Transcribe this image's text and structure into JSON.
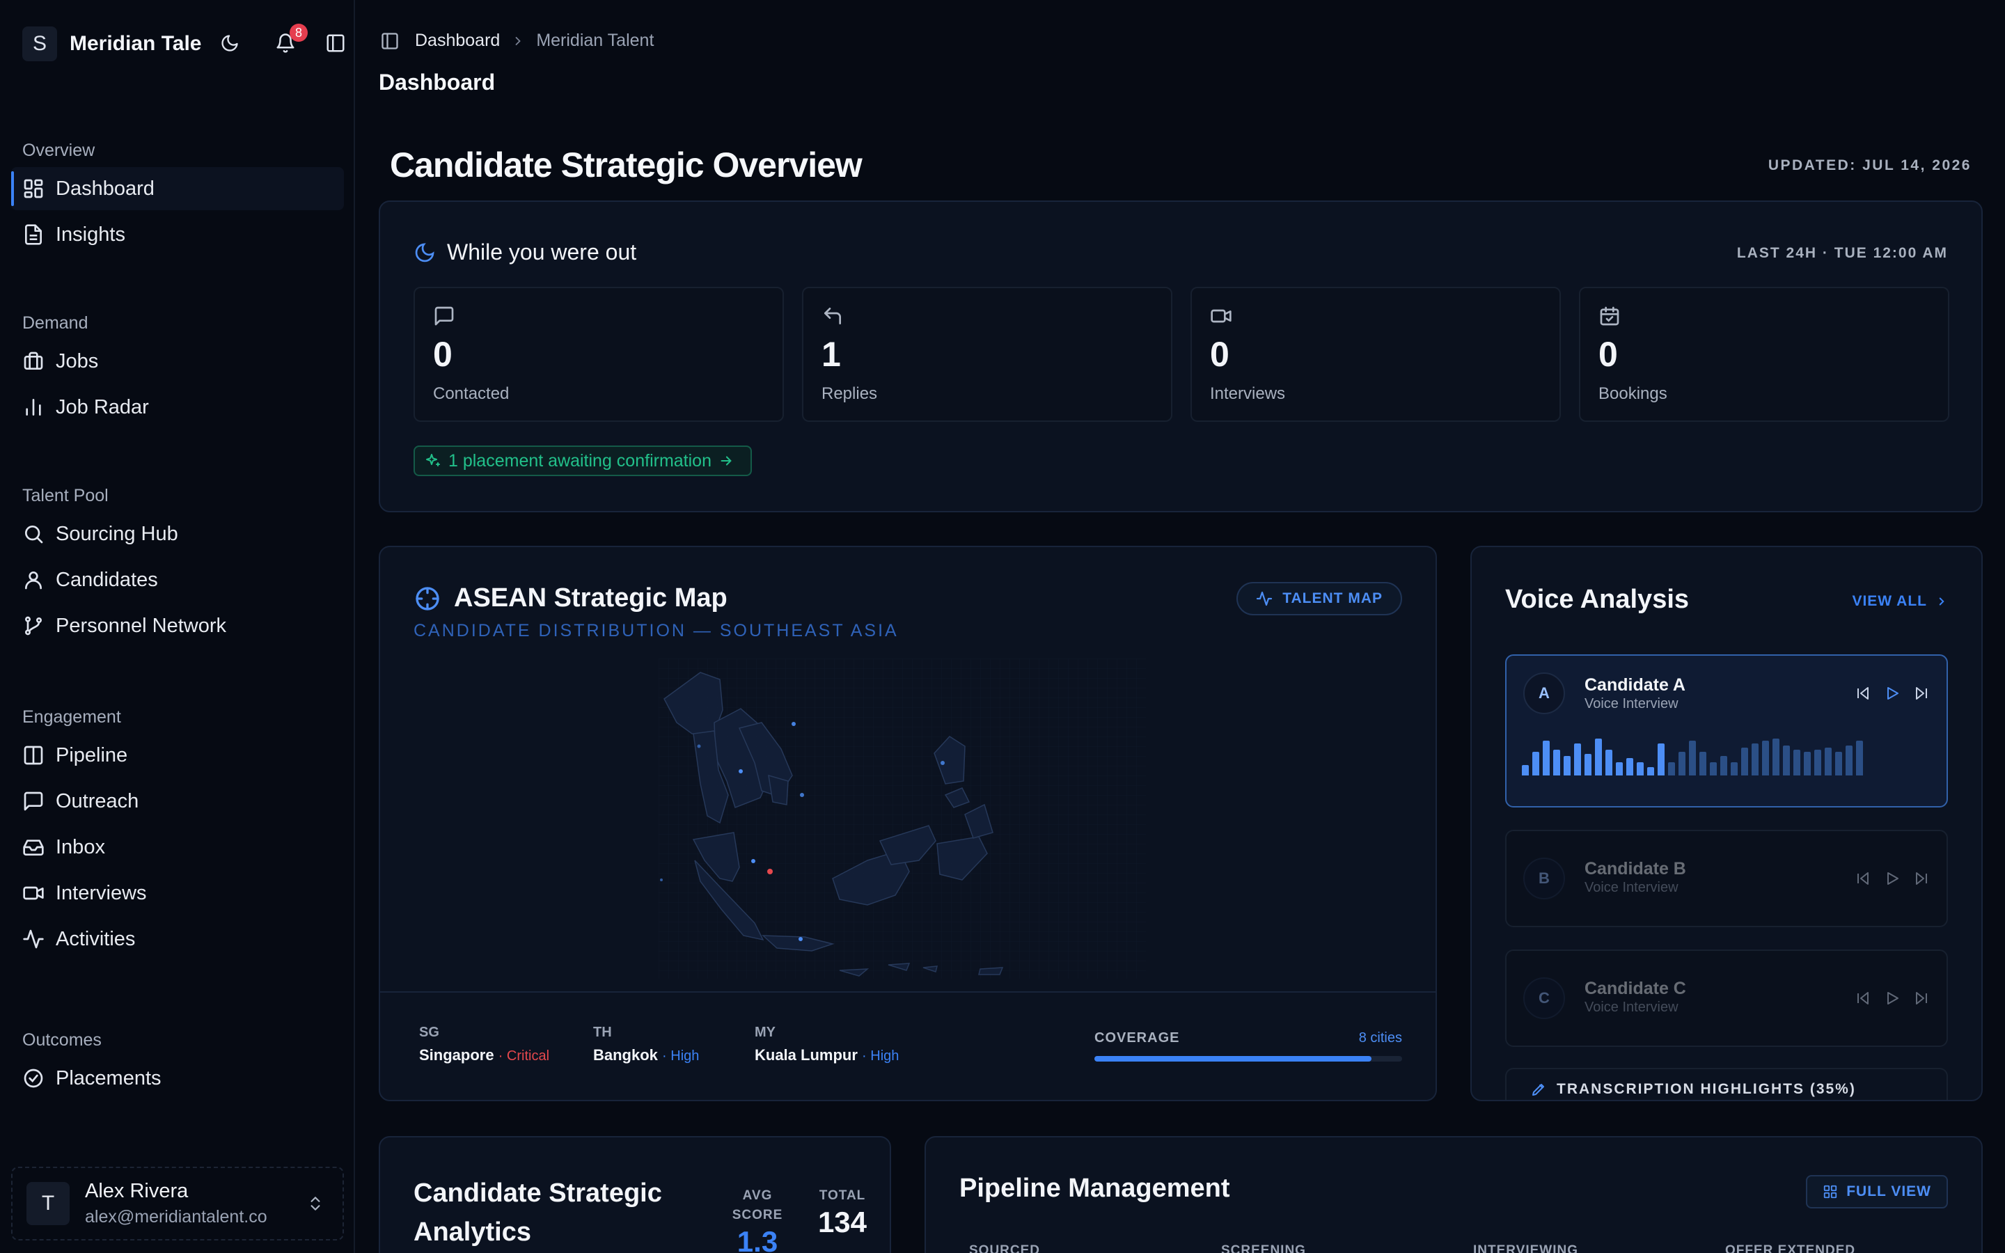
{
  "brand": {
    "logo_letter": "S",
    "name": "Meridian Tale"
  },
  "notifications": {
    "count": "8"
  },
  "sidebar": {
    "groups": [
      {
        "heading": "Overview",
        "items": [
          {
            "label": "Dashboard",
            "icon": "grid-icon",
            "active": true
          },
          {
            "label": "Insights",
            "icon": "document-icon"
          }
        ]
      },
      {
        "heading": "Demand",
        "items": [
          {
            "label": "Jobs",
            "icon": "briefcase-icon"
          },
          {
            "label": "Job Radar",
            "icon": "bar-chart-icon"
          }
        ]
      },
      {
        "heading": "Talent Pool",
        "items": [
          {
            "label": "Sourcing Hub",
            "icon": "search-icon"
          },
          {
            "label": "Candidates",
            "icon": "user-icon"
          },
          {
            "label": "Personnel Network",
            "icon": "network-icon"
          }
        ]
      },
      {
        "heading": "Engagement",
        "items": [
          {
            "label": "Pipeline",
            "icon": "columns-icon"
          },
          {
            "label": "Outreach",
            "icon": "message-icon"
          },
          {
            "label": "Inbox",
            "icon": "inbox-icon"
          },
          {
            "label": "Interviews",
            "icon": "video-icon"
          },
          {
            "label": "Activities",
            "icon": "activity-icon"
          }
        ]
      },
      {
        "heading": "Outcomes",
        "items": [
          {
            "label": "Placements",
            "icon": "check-circle-icon"
          }
        ]
      }
    ]
  },
  "user": {
    "initial": "T",
    "name": "Alex Rivera",
    "email": "alex@meridiantalent.co"
  },
  "breadcrumb": {
    "items": [
      "Dashboard",
      "Meridian Talent"
    ]
  },
  "page": {
    "title": "Dashboard"
  },
  "overview": {
    "title": "Candidate Strategic Overview",
    "updated": "UPDATED: JUL 14, 2026"
  },
  "while_out": {
    "title": "While you were out",
    "time": "LAST 24H · TUE 12:00 AM",
    "stats": [
      {
        "value": "0",
        "label": "Contacted",
        "icon": "message-square-icon"
      },
      {
        "value": "1",
        "label": "Replies",
        "icon": "reply-icon"
      },
      {
        "value": "0",
        "label": "Interviews",
        "icon": "video-icon"
      },
      {
        "value": "0",
        "label": "Bookings",
        "icon": "calendar-check-icon"
      }
    ],
    "placement_notice": "1 placement awaiting confirmation"
  },
  "map": {
    "title": "ASEAN Strategic Map",
    "subtitle": "CANDIDATE DISTRIBUTION — SOUTHEAST ASIA",
    "button": "TALENT MAP",
    "cities": [
      {
        "code": "SG",
        "name": "Singapore",
        "level": "· Critical",
        "level_color": "#e5484d"
      },
      {
        "code": "TH",
        "name": "Bangkok",
        "level": "· High",
        "level_color": "#3b82f6"
      },
      {
        "code": "MY",
        "name": "Kuala Lumpur",
        "level": "· High",
        "level_color": "#3b82f6"
      }
    ],
    "coverage_label": "COVERAGE",
    "coverage_value": "8 cities",
    "coverage_fraction": 0.9
  },
  "voice": {
    "title": "Voice Analysis",
    "view_all": "VIEW ALL",
    "candidates": [
      {
        "initial": "A",
        "name": "Candidate A",
        "sub": "Voice Interview"
      },
      {
        "initial": "B",
        "name": "Candidate B",
        "sub": "Voice Interview"
      },
      {
        "initial": "C",
        "name": "Candidate C",
        "sub": "Voice Interview"
      }
    ],
    "transcription": "TRANSCRIPTION HIGHLIGHTS (35%)"
  },
  "analytics": {
    "title": "Candidate Strategic Analytics",
    "avg_label": "AVG SCORE",
    "avg_value": "1.3",
    "total_label": "TOTAL",
    "total_value": "134"
  },
  "pipeline": {
    "title": "Pipeline Management",
    "button": "FULL VIEW",
    "stages": [
      "SOURCED",
      "SCREENING",
      "INTERVIEWING",
      "OFFER EXTENDED"
    ]
  },
  "colors": {
    "accent": "#3b82f6",
    "success": "#22c08a",
    "critical": "#e5484d",
    "badge": "#e53e4f"
  }
}
